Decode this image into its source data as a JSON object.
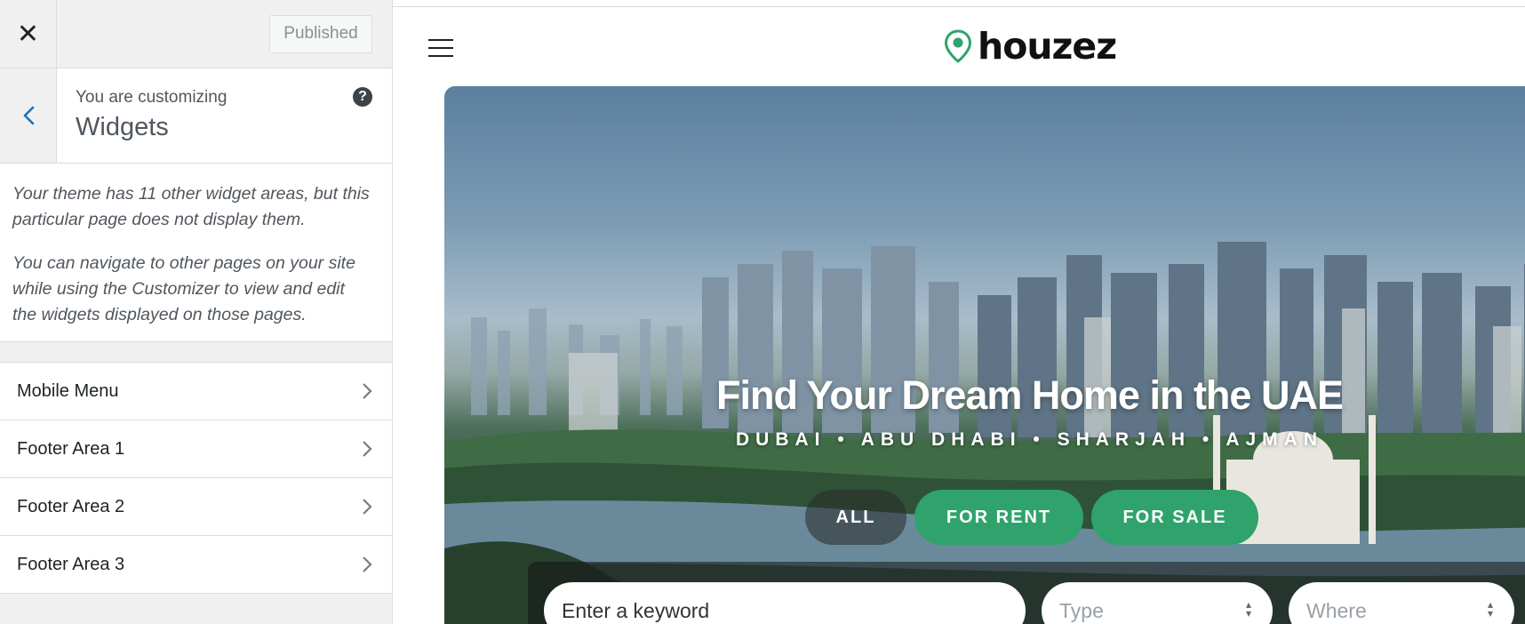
{
  "sidebar": {
    "published_label": "Published",
    "customizing_label": "You are customizing",
    "customizing_title": "Widgets",
    "notice_1": "Your theme has 11 other widget areas, but this particular page does not display them.",
    "notice_2": "You can navigate to other pages on your site while using the Customizer to view and edit the widgets displayed on those pages.",
    "sections": [
      {
        "label": "Mobile Menu"
      },
      {
        "label": "Footer Area 1"
      },
      {
        "label": "Footer Area 2"
      },
      {
        "label": "Footer Area 3"
      }
    ]
  },
  "preview": {
    "logo_text": "houzez",
    "hero_title": "Find Your Dream Home in the UAE",
    "hero_subtitle": "DUBAI • ABU DHABI • SHARJAH • AJMAN",
    "tabs": [
      {
        "label": "ALL"
      },
      {
        "label": "FOR RENT"
      },
      {
        "label": "FOR SALE"
      }
    ],
    "search": {
      "keyword_placeholder": "Enter a keyword",
      "type_placeholder": "Type",
      "where_placeholder": "Where"
    }
  },
  "colors": {
    "accent_green": "#2fa36b",
    "wp_blue": "#2271b1"
  }
}
